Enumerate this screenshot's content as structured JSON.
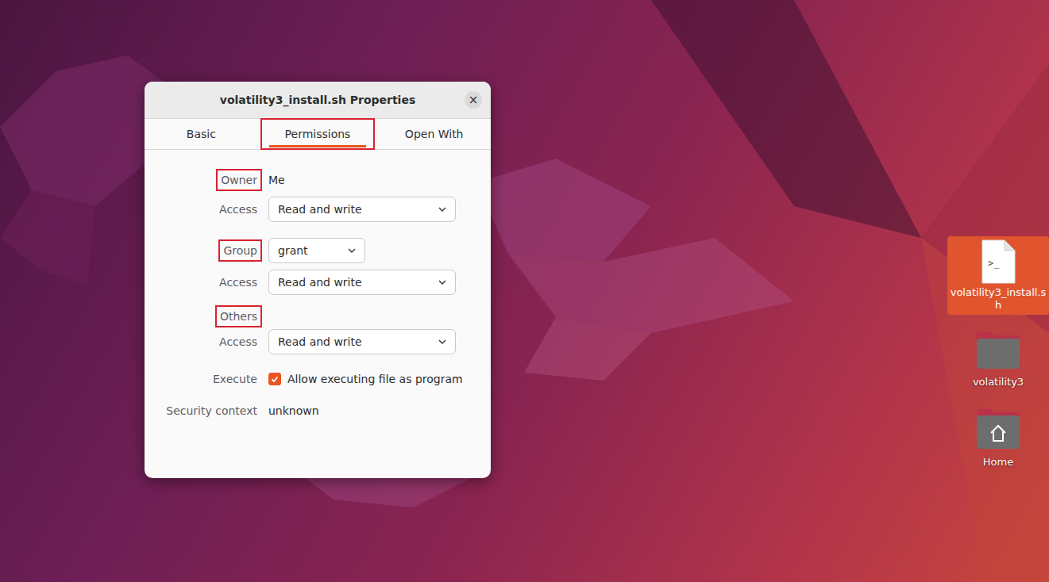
{
  "dialog": {
    "title": "volatility3_install.sh Properties",
    "close": "×"
  },
  "tabs": [
    {
      "label": "Basic",
      "selected": false,
      "highlighted": false
    },
    {
      "label": "Permissions",
      "selected": true,
      "highlighted": true
    },
    {
      "label": "Open With",
      "selected": false,
      "highlighted": false
    }
  ],
  "owner": {
    "label": "Owner",
    "highlighted": true,
    "value": "Me",
    "access_label": "Access",
    "access": "Read and write"
  },
  "group": {
    "label": "Group",
    "highlighted": true,
    "value": "grant",
    "access_label": "Access",
    "access": "Read and write"
  },
  "others": {
    "label": "Others",
    "highlighted": true,
    "access_label": "Access",
    "access": "Read and write"
  },
  "execute": {
    "label": "Execute",
    "option": "Allow executing file as program",
    "checked": true
  },
  "security": {
    "label": "Security context",
    "value": "unknown"
  },
  "desktop_icons": [
    {
      "label": "volatility3_install.sh",
      "kind": "script",
      "glyph": ">_",
      "selected": true
    },
    {
      "label": "volatility3",
      "kind": "folder",
      "selected": false
    },
    {
      "label": "Home",
      "kind": "home",
      "selected": false
    }
  ]
}
